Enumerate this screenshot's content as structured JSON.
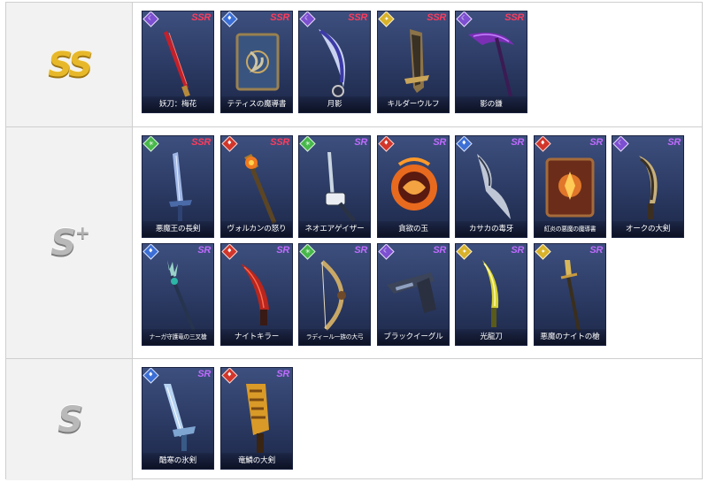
{
  "colors": {
    "wind": "#47b84a",
    "fire": "#d2362a",
    "water": "#3c6fd6",
    "dark": "#7d4fd1",
    "light": "#d8b22a",
    "ssr": "#ff3b5c",
    "sr": "#c06bff"
  },
  "tiers": [
    {
      "label": "SS",
      "plus": "",
      "style": "gold",
      "weapons": [
        {
          "name": "妖刀：梅花",
          "rarity": "SSR",
          "element": "dark",
          "icon": "red-katana-icon",
          "art": "katana"
        },
        {
          "name": "テティスの魔導書",
          "rarity": "SSR",
          "element": "water",
          "icon": "grimoire-icon",
          "art": "book-blue"
        },
        {
          "name": "月影",
          "rarity": "SSR",
          "element": "dark",
          "icon": "moon-blade-icon",
          "art": "moonblade"
        },
        {
          "name": "キルダーウルフ",
          "rarity": "SSR",
          "element": "light",
          "icon": "wolf-sword-icon",
          "art": "wolfsword"
        },
        {
          "name": "影の鎌",
          "rarity": "SSR",
          "element": "dark",
          "icon": "scythe-icon",
          "art": "scythe"
        }
      ]
    },
    {
      "label": "S",
      "plus": "+",
      "style": "silver",
      "weapons": [
        {
          "name": "悪魔王の長剣",
          "rarity": "SSR",
          "element": "wind",
          "icon": "longsword-icon",
          "art": "longsword"
        },
        {
          "name": "ヴォルカンの怒り",
          "rarity": "SSR",
          "element": "fire",
          "icon": "fire-staff-icon",
          "art": "firestaff"
        },
        {
          "name": "ネオエアゲイザー",
          "rarity": "SR",
          "element": "wind",
          "icon": "gun-lance-icon",
          "art": "gunlance"
        },
        {
          "name": "貪欲の玉",
          "rarity": "SR",
          "element": "fire",
          "icon": "orb-icon",
          "art": "orb"
        },
        {
          "name": "カサカの毒牙",
          "rarity": "SR",
          "element": "water",
          "icon": "fang-blade-icon",
          "art": "fang"
        },
        {
          "name": "紅炎の悪魔の魔導書",
          "rarity": "SR",
          "element": "fire",
          "icon": "grimoire-icon",
          "art": "book-red",
          "small": true
        },
        {
          "name": "オークの大剣",
          "rarity": "SR",
          "element": "dark",
          "icon": "greatsword-icon",
          "art": "orcsword"
        },
        {
          "name": "ナーガ守護竜の三叉槍",
          "rarity": "SR",
          "element": "water",
          "icon": "trident-icon",
          "art": "trident",
          "small": true
        },
        {
          "name": "ナイトキラー",
          "rarity": "SR",
          "element": "fire",
          "icon": "red-blade-icon",
          "art": "redblade"
        },
        {
          "name": "ラディール一族の大弓",
          "rarity": "SR",
          "element": "wind",
          "icon": "bow-icon",
          "art": "bow",
          "small": true
        },
        {
          "name": "ブラックイーグル",
          "rarity": "SR",
          "element": "dark",
          "icon": "pistol-icon",
          "art": "pistol"
        },
        {
          "name": "光龍刀",
          "rarity": "SR",
          "element": "light",
          "icon": "dragon-blade-icon",
          "art": "yellowblade"
        },
        {
          "name": "悪魔のナイトの槍",
          "rarity": "SR",
          "element": "light",
          "icon": "spear-icon",
          "art": "spear"
        }
      ]
    },
    {
      "label": "S",
      "plus": "",
      "style": "silver",
      "weapons": [
        {
          "name": "酷寒の氷剣",
          "rarity": "SR",
          "element": "water",
          "icon": "ice-sword-icon",
          "art": "icesword"
        },
        {
          "name": "竜鱗の大剣",
          "rarity": "SR",
          "element": "fire",
          "icon": "dragon-greatsword-icon",
          "art": "scalesword"
        }
      ]
    }
  ]
}
